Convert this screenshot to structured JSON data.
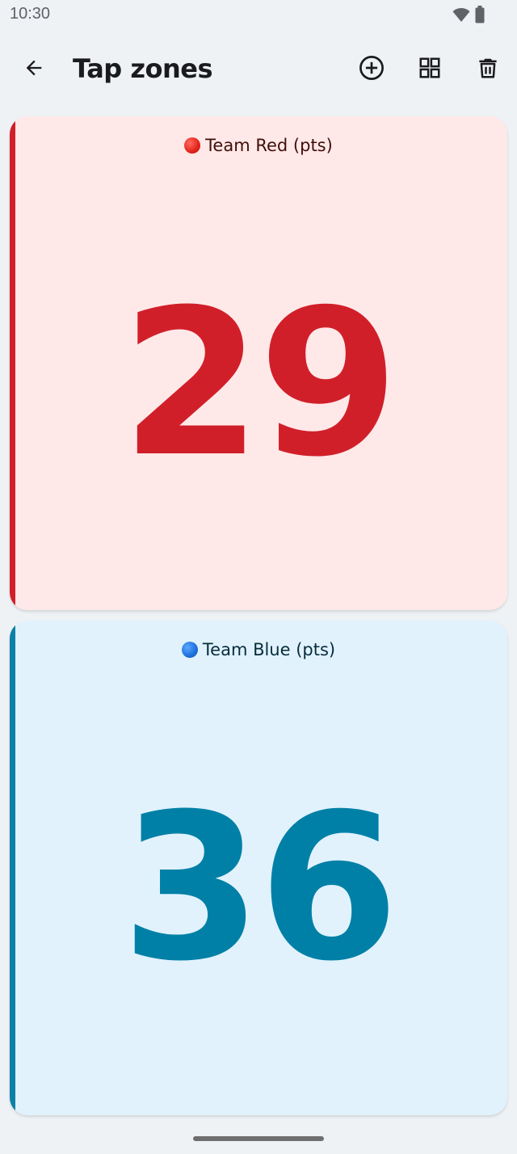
{
  "status_bar": {
    "time": "10:30",
    "icons": [
      "wifi-icon",
      "battery-icon"
    ]
  },
  "app_bar": {
    "title": "Tap zones",
    "back_icon": "arrow-left-icon",
    "actions": [
      "add-circle-icon",
      "grid-icon",
      "trash-icon"
    ]
  },
  "zones": [
    {
      "label": "Team Red (pts)",
      "value": "29",
      "dot_icon": "red-circle-icon",
      "accent_color": "#d11f2a",
      "background_color": "#ffe9e8"
    },
    {
      "label": "Team Blue (pts)",
      "value": "36",
      "dot_icon": "blue-circle-icon",
      "accent_color": "#0080a6",
      "background_color": "#e1f2fd"
    }
  ]
}
